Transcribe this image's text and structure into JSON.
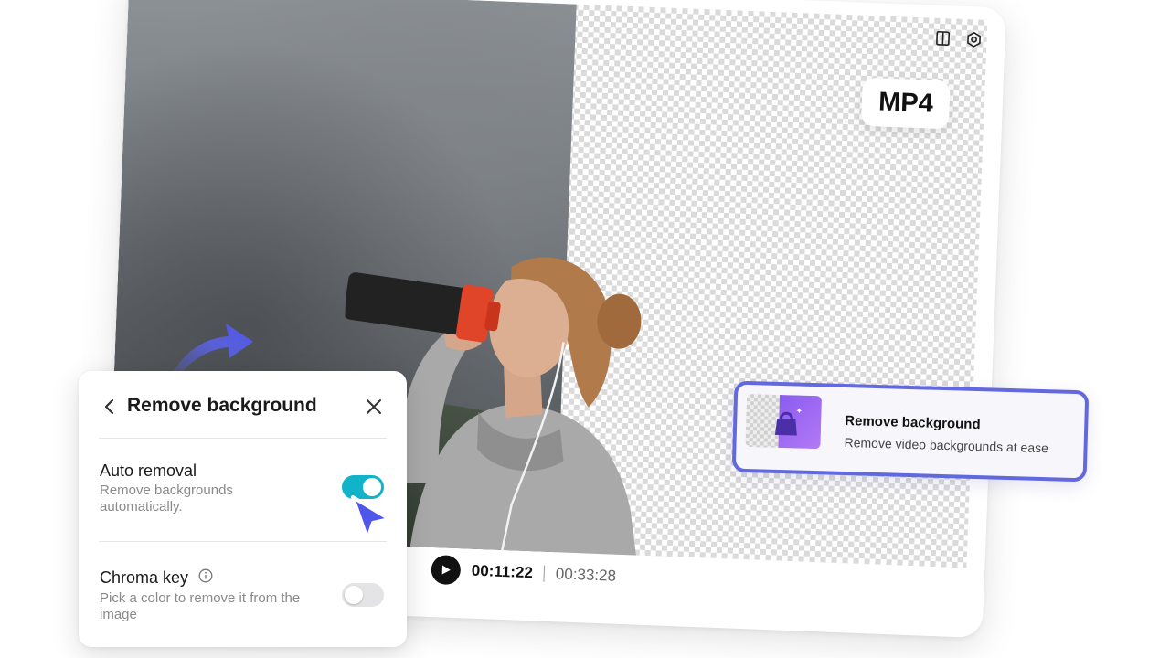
{
  "video_window": {
    "format_badge": "MP4",
    "toolbar": {
      "icons": [
        "compare-view-icon",
        "settings-icon"
      ]
    },
    "playback": {
      "current_time": "00:11:22",
      "total_time": "00:33:28"
    }
  },
  "feature_card": {
    "title": "Remove background",
    "subtitle": "Remove video backgrounds at ease"
  },
  "panel": {
    "title": "Remove background",
    "options": [
      {
        "title": "Auto removal",
        "description": "Remove backgrounds automatically.",
        "enabled": true
      },
      {
        "title": "Chroma key",
        "description": "Pick a color to remove it from the image",
        "enabled": false
      }
    ]
  },
  "colors": {
    "toggle_on": "#11b3c9",
    "card_border": "#6268e0",
    "accent_arrow": "#5b63ee"
  }
}
